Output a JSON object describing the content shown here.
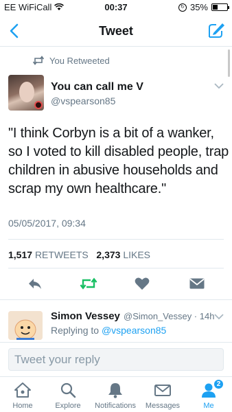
{
  "status_bar": {
    "carrier": "EE WiFiCall",
    "time": "00:37",
    "battery": "35%",
    "battery_level": 0.35
  },
  "nav": {
    "title": "Tweet"
  },
  "retweet_header": {
    "label": "You Retweeted"
  },
  "tweet": {
    "author_name": "You can call me V",
    "author_handle": "@vspearson85",
    "text": "\"I think Corbyn is a bit of a wanker, so I voted to kill disabled people, trap children in abusive households and scrap my own healthcare.\"",
    "date": "05/05/2017, 09:34",
    "retweet_count": "1,517",
    "retweet_label": "RETWEETS",
    "like_count": "2,373",
    "like_label": "LIKES"
  },
  "reply": {
    "author_name": "Simon Vessey",
    "handle_time": "@Simon_Vessey · 14h",
    "replying_prefix": "Replying to",
    "replying_handle": "@vspearson85"
  },
  "composer": {
    "placeholder": "Tweet your reply"
  },
  "tabs": [
    {
      "label": "Home",
      "icon": "home-icon"
    },
    {
      "label": "Explore",
      "icon": "search-icon"
    },
    {
      "label": "Notifications",
      "icon": "bell-icon"
    },
    {
      "label": "Messages",
      "icon": "envelope-icon"
    },
    {
      "label": "Me",
      "icon": "person-icon",
      "badge": "2"
    }
  ],
  "colors": {
    "accent": "#1da1f2",
    "retweet_green": "#17bf63",
    "muted": "#657786",
    "icon_gray": "#657786"
  }
}
